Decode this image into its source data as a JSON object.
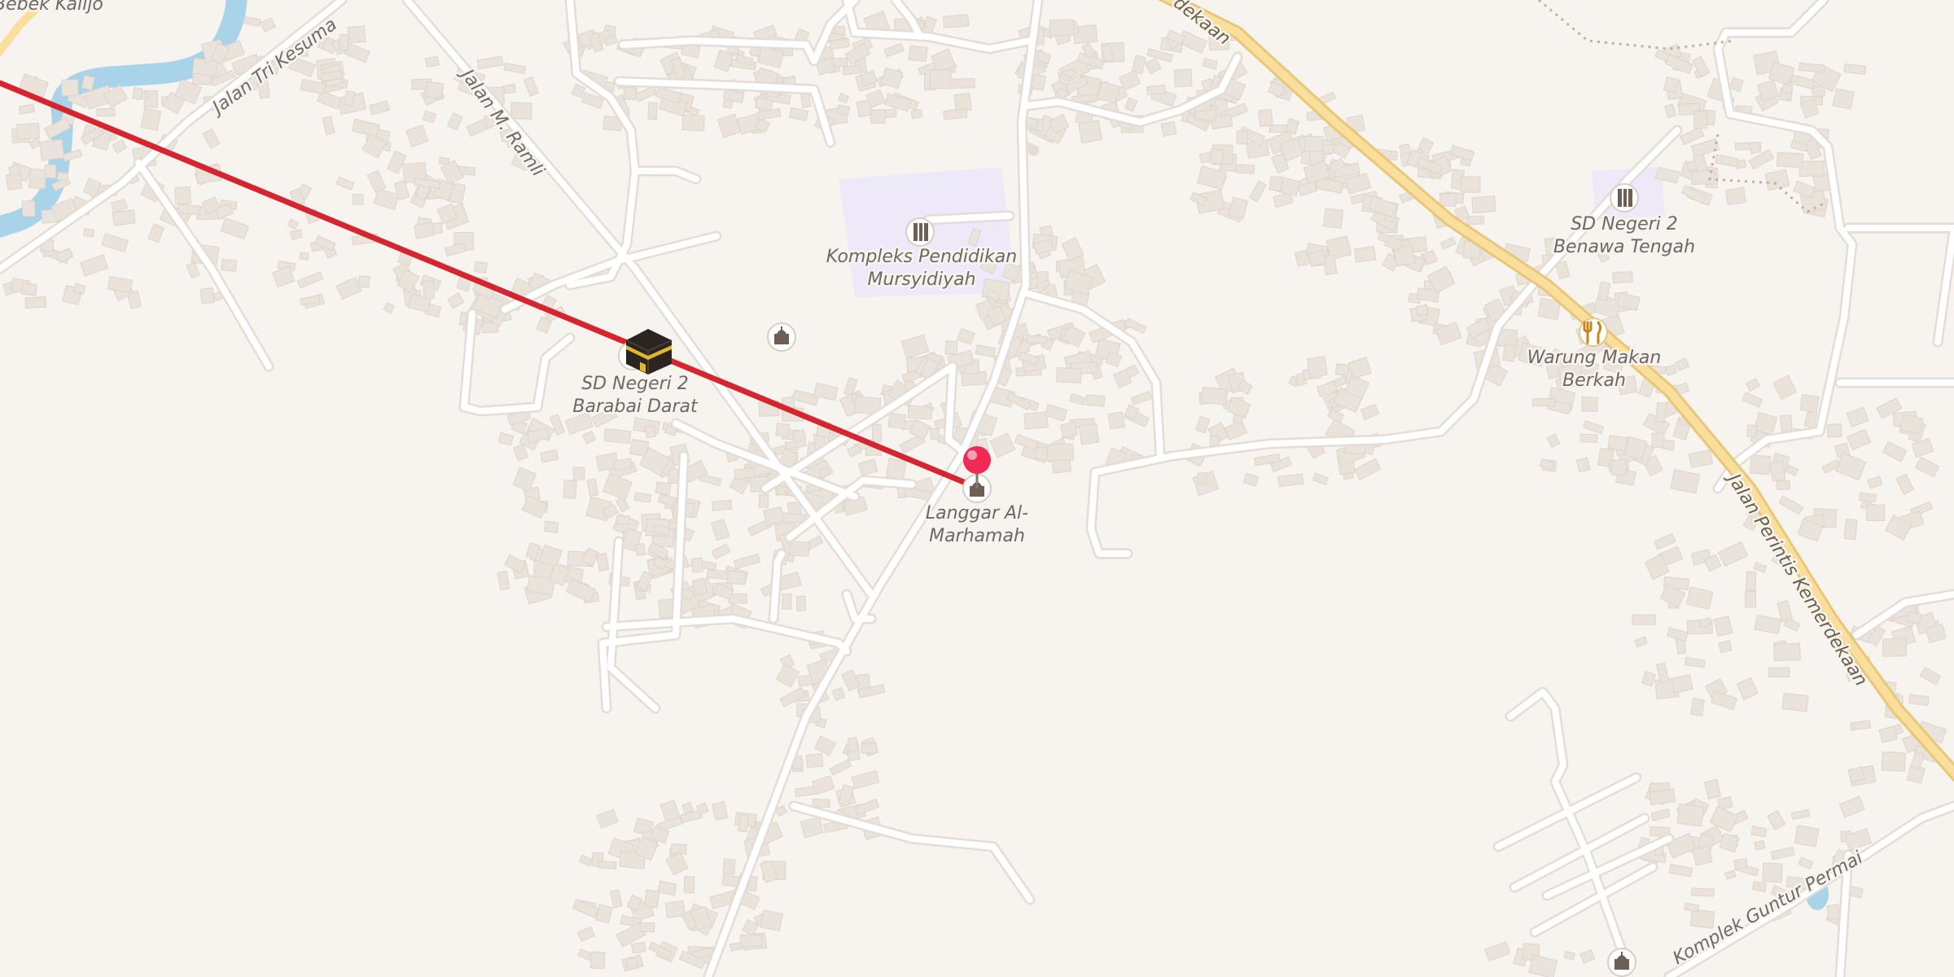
{
  "map": {
    "colors": {
      "land": "#f7f4f0",
      "road_minor": "#ffffff",
      "road_casing": "#e3ddd6",
      "road_major": "#f9df9b",
      "road_major_casing": "#e8c77a",
      "water": "#a9d3e9",
      "school_area": "#ece6fa",
      "route_line": "#d5252e",
      "pin": "#ee2a55"
    },
    "street_labels": {
      "jalan_tri_kesuma": "Jalan Tri Kesuma",
      "jalan_m_ramli": "Jalan M. Ramli",
      "jalan_merdeka_top": "dekaan",
      "jalan_perintis": "Jalan Perintis Kemerdekaan",
      "komplek_guntur": "Komplek Guntur Permai",
      "bebek_kalijo": "Bebek Kalijo"
    },
    "pois": {
      "sd_barabai": {
        "line1": "SD Negeri 2",
        "line2": "Barabai Darat",
        "icon": "kaaba-icon"
      },
      "kompleks_pendidikan": {
        "line1": "Kompleks Pendidikan",
        "line2": "Mursyidiyah",
        "icon": "school-icon"
      },
      "sd_benawa": {
        "line1": "SD Negeri 2",
        "line2": "Benawa Tengah",
        "icon": "school-icon"
      },
      "warung_makan": {
        "line1": "Warung Makan",
        "line2": "Berkah",
        "icon": "restaurant-icon"
      },
      "langgar": {
        "line1": "Langgar Al-",
        "line2": "Marhamah",
        "icon": "mosque-icon"
      },
      "unnamed_mosque": {
        "icon": "mosque-icon"
      },
      "bottom_mosque": {
        "icon": "mosque-icon"
      }
    },
    "route": {
      "description": "qibla-direction-line",
      "from": "Langgar Al-Marhamah"
    }
  }
}
